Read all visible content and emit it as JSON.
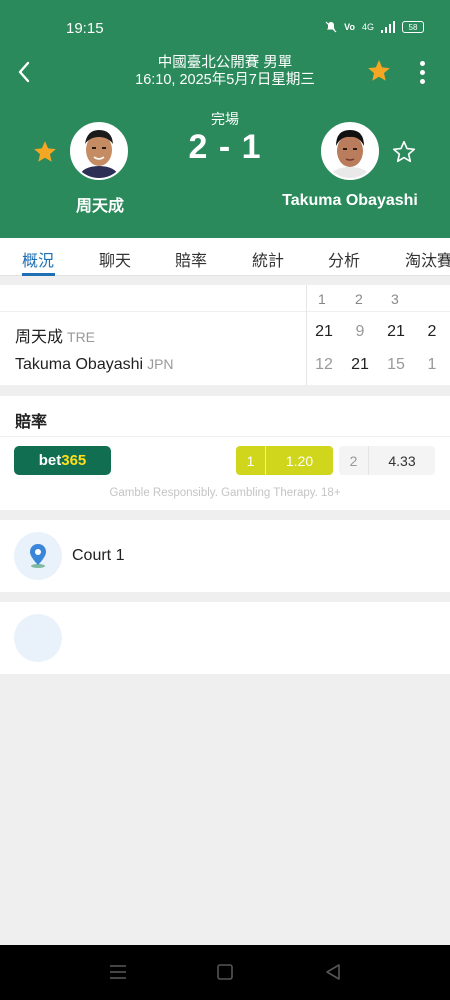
{
  "status_bar": {
    "time": "19:15",
    "signal_text": "4G",
    "battery": "58"
  },
  "header": {
    "tournament": "中國臺北公開賽 男單",
    "datetime": "16:10, 2025年5月7日星期三",
    "match_status": "完場",
    "score": "2 - 1",
    "player1": {
      "name": "周天成",
      "favorite": true
    },
    "player2": {
      "name": "Takuma Obayashi",
      "favorite": false
    },
    "colors": {
      "header_bg": "#2a8a5b",
      "star": "#f5a623"
    }
  },
  "tabs": [
    {
      "label": "概況",
      "active": true
    },
    {
      "label": "聊天",
      "active": false
    },
    {
      "label": "賠率",
      "active": false
    },
    {
      "label": "統計",
      "active": false
    },
    {
      "label": "分析",
      "active": false
    },
    {
      "label": "淘汰賽",
      "active": false
    }
  ],
  "scorecard": {
    "set_headers": [
      "1",
      "2",
      "3"
    ],
    "rows": [
      {
        "name": "周天成",
        "code": "TRE",
        "sets": [
          "21",
          "9",
          "21"
        ],
        "total": "2"
      },
      {
        "name": "Takuma Obayashi",
        "code": "JPN",
        "sets": [
          "12",
          "21",
          "15"
        ],
        "total": "1"
      }
    ]
  },
  "odds": {
    "title": "賠率",
    "bookmaker": {
      "part1": "bet",
      "part2": "365"
    },
    "option1": {
      "label": "1",
      "value": "1.20"
    },
    "option2": {
      "label": "2",
      "value": "4.33"
    },
    "disclaimer": "Gamble Responsibly. Gambling Therapy. 18+",
    "colors": {
      "bookmaker_bg": "#126e51",
      "option1_bg": "#cfd61c"
    }
  },
  "venue": {
    "name": "Court 1",
    "icon": "location-pin-icon"
  }
}
